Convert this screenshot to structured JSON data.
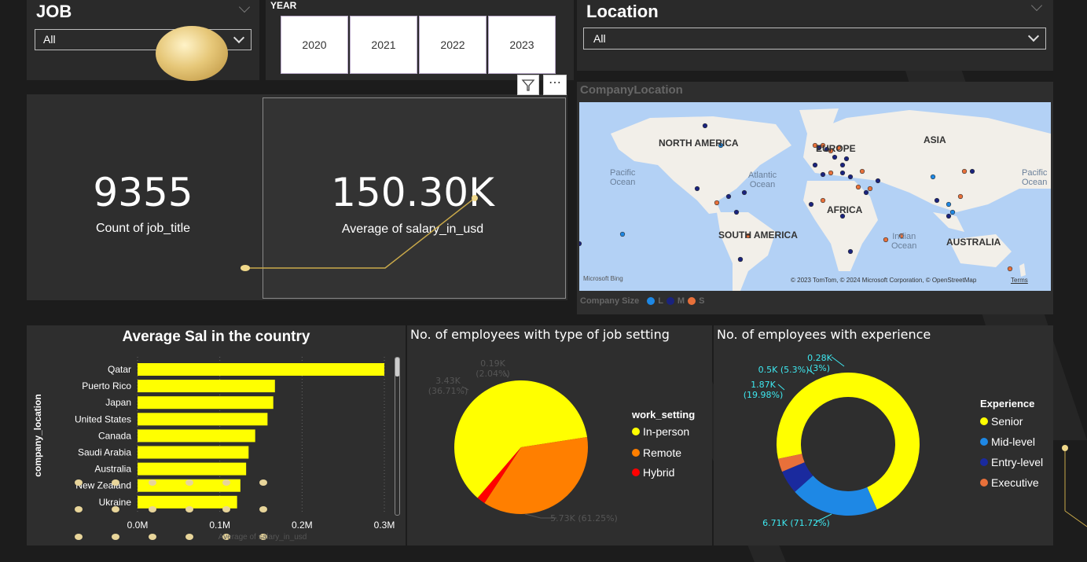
{
  "job_slicer": {
    "title": "JOB",
    "value": "All"
  },
  "year_slicer": {
    "title": "YEAR",
    "years": [
      "2020",
      "2021",
      "2022",
      "2023"
    ]
  },
  "location_slicer": {
    "title": "Location",
    "value": "All"
  },
  "kpi_count": {
    "value": "9355",
    "label": "Count of job_title"
  },
  "kpi_avg": {
    "value": "150.30K",
    "label": "Average of salary_in_usd"
  },
  "map": {
    "title": "CompanyLocation",
    "labels": {
      "north_america": "NORTH AMERICA",
      "europe": "EUROPE",
      "asia": "ASIA",
      "africa": "AFRICA",
      "south_america": "SOUTH AMERICA",
      "australia": "AUSTRALIA",
      "pacific": "Pacific\nOcean",
      "pacific_right": "Pacific\nOcean",
      "atlantic": "Atlantic\nOcean",
      "indian": "Indian\nOcean"
    },
    "attribution": "© 2023 TomTom, © 2024 Microsoft Corporation, © OpenStreetMap",
    "terms": "Terms",
    "bing": "Microsoft Bing",
    "size_legend_title": "Company Size",
    "size_legend": [
      "L",
      "M",
      "S"
    ],
    "colors": {
      "L": "#1e88e5",
      "M": "#1a237e",
      "S": "#e8703a"
    }
  },
  "chart_data": [
    {
      "type": "bar",
      "title": "Average Sal in the country",
      "ylabel": "company_location",
      "xlabel": "Average of salary_in_usd",
      "categories": [
        "Qatar",
        "Puerto Rico",
        "Japan",
        "United States",
        "Canada",
        "Saudi Arabia",
        "Australia",
        "New Zealand",
        "Ukraine"
      ],
      "values": [
        300000,
        167000,
        165000,
        158000,
        143000,
        135000,
        132000,
        125000,
        121000
      ],
      "xticks": [
        "0.0M",
        "0.1M",
        "0.2M",
        "0.3M"
      ],
      "xlim": [
        0,
        300000
      ],
      "color": "#ffff00"
    },
    {
      "type": "pie",
      "title": "No. of employees with type of job setting",
      "legend_title": "work_setting",
      "slices": [
        {
          "name": "In-person",
          "value": 5730,
          "label": "5.73K (61.25%)",
          "color": "#ffff00"
        },
        {
          "name": "Remote",
          "value": 3430,
          "label": "3.43K\n(36.71%)",
          "color": "#ff7f00"
        },
        {
          "name": "Hybrid",
          "value": 190,
          "label": "0.19K\n(2.04%)",
          "color": "#ff0000"
        }
      ]
    },
    {
      "type": "pie",
      "title": "No. of employees with experience",
      "legend_title": "Experience",
      "slices": [
        {
          "name": "Senior",
          "value": 6710,
          "label": "6.71K (71.72%)",
          "color": "#ffff00"
        },
        {
          "name": "Mid-level",
          "value": 1870,
          "label": "1.87K\n(19.98%)",
          "color": "#1e88e5"
        },
        {
          "name": "Entry-level",
          "value": 500,
          "label": "0.5K (5.3%)",
          "color": "#1a2a9e"
        },
        {
          "name": "Executive",
          "value": 280,
          "label": "0.28K\n(3%)",
          "color": "#e8703a"
        }
      ]
    }
  ]
}
